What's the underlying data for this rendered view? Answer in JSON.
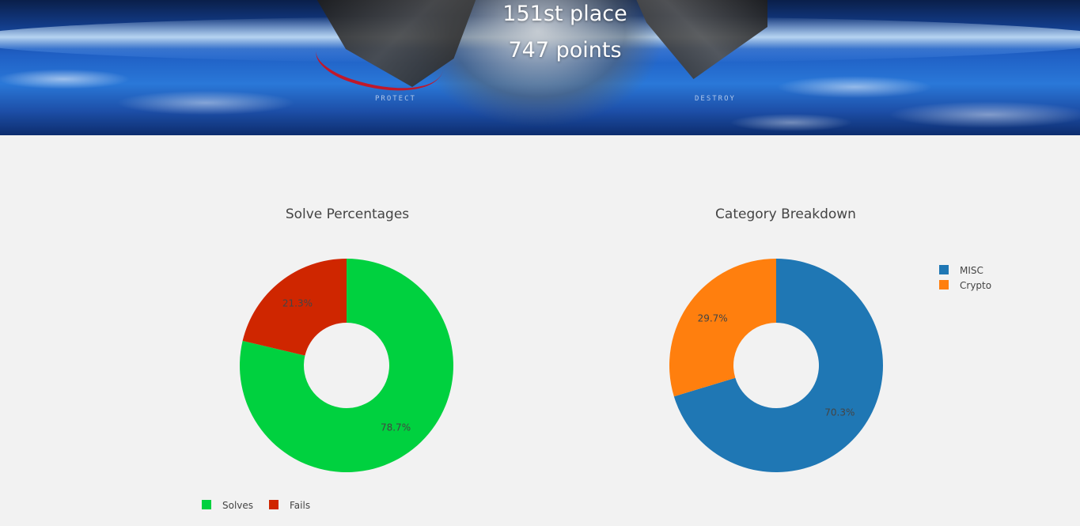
{
  "header": {
    "rank_text": "151st place",
    "points_text": "747 points",
    "art_left_text": "PROTECT",
    "art_right_text": "DESTROY"
  },
  "chart_data": [
    {
      "type": "pie",
      "donut": true,
      "title": "Solve Percentages",
      "labels": [
        "Solves",
        "Fails"
      ],
      "values": [
        78.7,
        21.3
      ],
      "value_labels": [
        "78.7%",
        "21.3%"
      ],
      "colors": [
        "#00d13f",
        "#cf2600"
      ],
      "legend_position": "bottom-left"
    },
    {
      "type": "pie",
      "donut": true,
      "title": "Category Breakdown",
      "labels": [
        "MISC",
        "Crypto"
      ],
      "values": [
        70.3,
        29.7
      ],
      "value_labels": [
        "70.3%",
        "29.7%"
      ],
      "colors": [
        "#1f77b4",
        "#ff7f0e"
      ],
      "legend_position": "top-right"
    }
  ]
}
